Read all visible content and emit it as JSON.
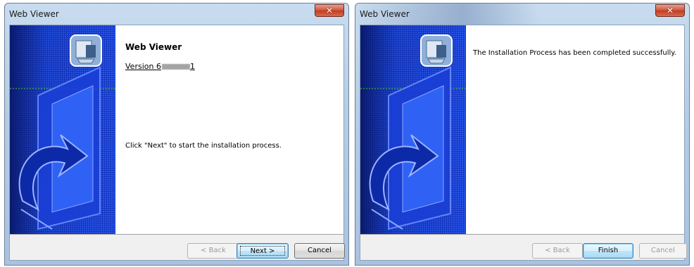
{
  "installer_start": {
    "title": "Web Viewer",
    "heading": "Web Viewer",
    "version_prefix": "Version 6",
    "version_suffix": "1",
    "message": "Click \"Next\" to start the installation process.",
    "buttons": {
      "back": "< Back",
      "next": "Next >",
      "cancel": "Cancel"
    }
  },
  "installer_finish": {
    "title": "Web Viewer",
    "message": "The Installation Process has been completed successfully.",
    "buttons": {
      "back": "< Back",
      "finish": "Finish",
      "cancel": "Cancel"
    }
  },
  "icons": {
    "close": "close-icon",
    "app": "installer-app-icon"
  },
  "colors": {
    "side_panel": "#1a3fd6",
    "side_panel_dark": "#0a1e7a",
    "accent_green": "#3ccf2b"
  }
}
